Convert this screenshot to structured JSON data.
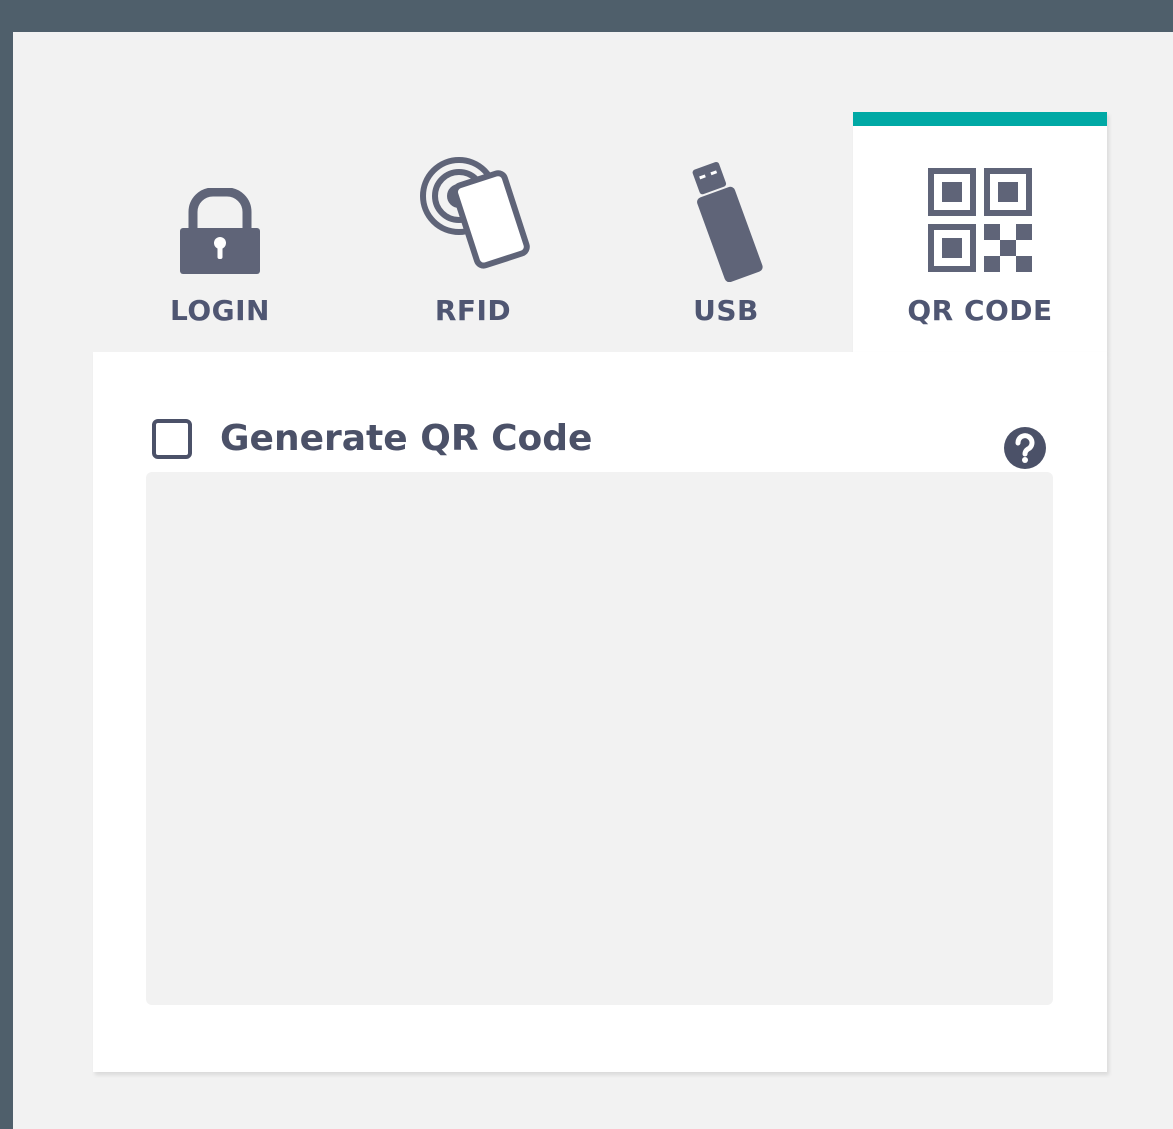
{
  "tabs": [
    {
      "key": "login",
      "label": "LOGIN",
      "icon": "lock-icon",
      "active": false
    },
    {
      "key": "rfid",
      "label": "RFID",
      "icon": "rfid-card-icon",
      "active": false
    },
    {
      "key": "usb",
      "label": "USB",
      "icon": "usb-drive-icon",
      "active": false
    },
    {
      "key": "qr",
      "label": "QR CODE",
      "icon": "qr-code-icon",
      "active": true
    }
  ],
  "panel": {
    "checkbox_label": "Generate QR Code",
    "checkbox_checked": false,
    "help_icon": "question-mark-icon"
  },
  "colors": {
    "background_dark": "#4f5f6b",
    "content_background": "#f2f2f2",
    "accent": "#00a9a5",
    "icon": "#5f6478",
    "text": "#4b5168"
  }
}
